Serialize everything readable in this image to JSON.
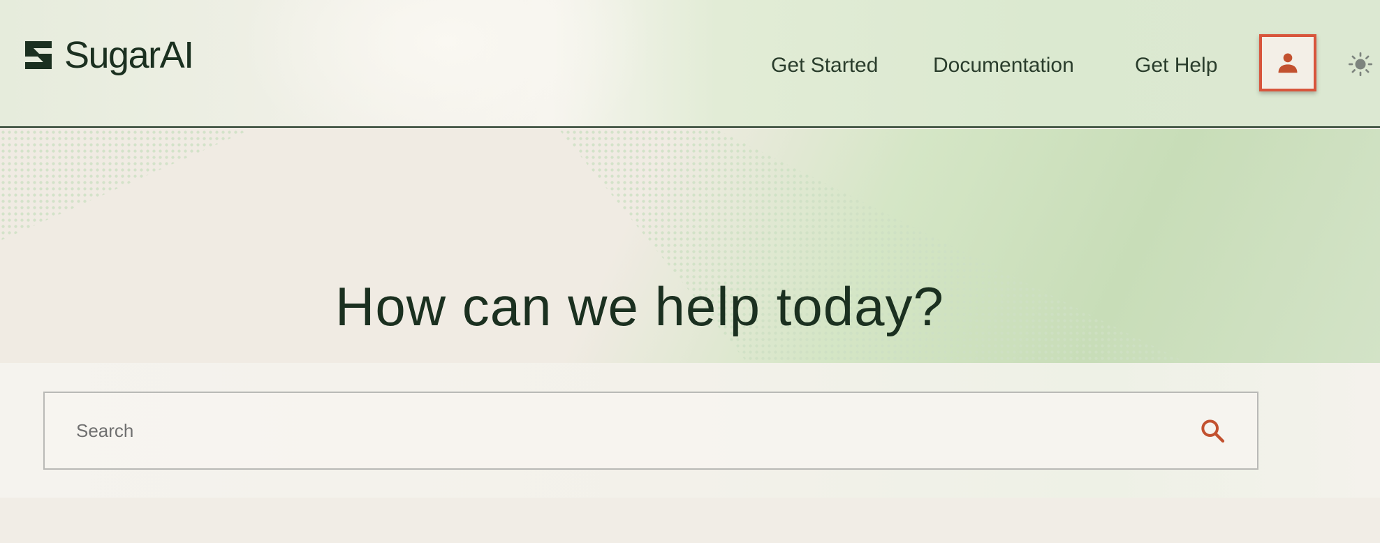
{
  "brand": {
    "name": "SugarAI"
  },
  "nav": {
    "items": [
      {
        "label": "Get Started"
      },
      {
        "label": "Documentation"
      },
      {
        "label": "Get Help"
      }
    ],
    "account_icon": "person-icon",
    "theme_icon": "sun-icon"
  },
  "hero": {
    "title": "How can we help today?"
  },
  "search": {
    "placeholder": "Search",
    "value": "",
    "icon": "search-icon"
  },
  "colors": {
    "accent": "#c2512f",
    "highlight_border": "#d8553c",
    "text_dark": "#1b3020"
  }
}
